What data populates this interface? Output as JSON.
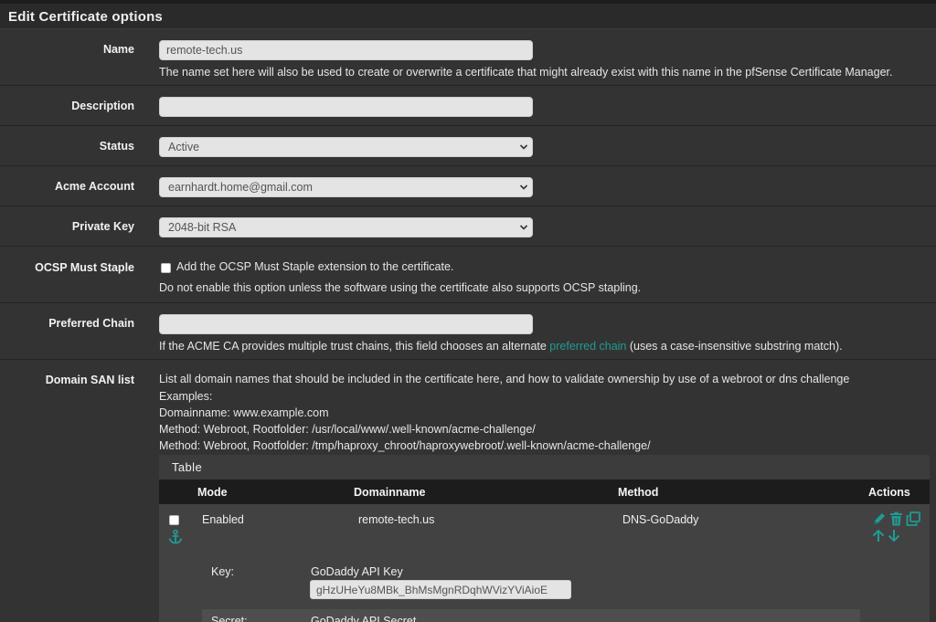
{
  "panel": {
    "title": "Edit Certificate options"
  },
  "name": {
    "label": "Name",
    "value": "remote-tech.us",
    "help": "The name set here will also be used to create or overwrite a certificate that might already exist with this name in the pfSense Certificate Manager."
  },
  "description": {
    "label": "Description",
    "value": ""
  },
  "status": {
    "label": "Status",
    "value": "Active"
  },
  "acme_account": {
    "label": "Acme Account",
    "value": "earnhardt.home@gmail.com"
  },
  "private_key": {
    "label": "Private Key",
    "value": "2048-bit RSA"
  },
  "ocsp": {
    "label": "OCSP Must Staple",
    "checkbox_label": "Add the OCSP Must Staple extension to the certificate.",
    "checked": false,
    "help": "Do not enable this option unless the software using the certificate also supports OCSP stapling."
  },
  "preferred_chain": {
    "label": "Preferred Chain",
    "value": "",
    "help_before": "If the ACME CA provides multiple trust chains, this field chooses an alternate ",
    "help_link": "preferred chain",
    "help_after": " (uses a case-insensitive substring match)."
  },
  "domain_san": {
    "label": "Domain SAN list",
    "help_lines": [
      "List all domain names that should be included in the certificate here, and how to validate ownership by use of a webroot or dns challenge",
      "Examples:",
      "Domainname: www.example.com",
      "Method: Webroot, Rootfolder: /usr/local/www/.well-known/acme-challenge/",
      "Method: Webroot, Rootfolder: /tmp/haproxy_chroot/haproxywebroot/.well-known/acme-challenge/"
    ],
    "table": {
      "title": "Table",
      "columns": [
        "Mode",
        "Domainname",
        "Method",
        "Actions"
      ],
      "rows": [
        {
          "mode": "Enabled",
          "domainname": "remote-tech.us",
          "method": "DNS-GoDaddy",
          "key_label": "Key:",
          "key_title": "GoDaddy API Key",
          "key_value": "gHzUHeYu8MBk_BhMsMgnRDqhWVizYViAioE",
          "secret_label": "Secret:",
          "secret_title": "GoDaddy API Secret"
        }
      ]
    }
  },
  "colors": {
    "accent": "#1f9c93",
    "background": "#333333",
    "table_header": "#1c1c1c"
  },
  "icons": [
    "chevron-down-icon",
    "anchor-icon",
    "pencil-icon",
    "trash-icon",
    "copy-icon",
    "arrow-up-icon",
    "arrow-down-icon"
  ]
}
